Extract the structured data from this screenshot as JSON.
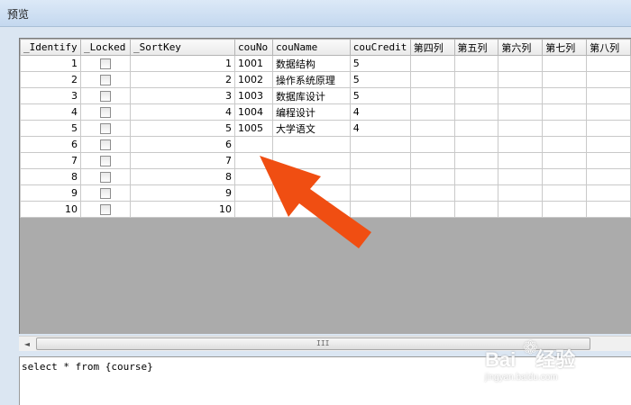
{
  "window": {
    "title": "预览"
  },
  "grid": {
    "columns": [
      "_Identify",
      "_Locked",
      "_SortKey",
      "couNo",
      "couName",
      "couCredit",
      "第四列",
      "第五列",
      "第六列",
      "第七列",
      "第八列"
    ],
    "rows": [
      {
        "identify": "1",
        "sortkey": "1",
        "couNo": "1001",
        "couName": "数据结构",
        "couCredit": "5"
      },
      {
        "identify": "2",
        "sortkey": "2",
        "couNo": "1002",
        "couName": "操作系统原理",
        "couCredit": "5"
      },
      {
        "identify": "3",
        "sortkey": "3",
        "couNo": "1003",
        "couName": "数据库设计",
        "couCredit": "5"
      },
      {
        "identify": "4",
        "sortkey": "4",
        "couNo": "1004",
        "couName": "编程设计",
        "couCredit": "4"
      },
      {
        "identify": "5",
        "sortkey": "5",
        "couNo": "1005",
        "couName": "大学语文",
        "couCredit": "4"
      },
      {
        "identify": "6",
        "sortkey": "6",
        "couNo": "",
        "couName": "",
        "couCredit": ""
      },
      {
        "identify": "7",
        "sortkey": "7",
        "couNo": "",
        "couName": "",
        "couCredit": ""
      },
      {
        "identify": "8",
        "sortkey": "8",
        "couNo": "",
        "couName": "",
        "couCredit": ""
      },
      {
        "identify": "9",
        "sortkey": "9",
        "couNo": "",
        "couName": "",
        "couCredit": ""
      },
      {
        "identify": "10",
        "sortkey": "10",
        "couNo": "",
        "couName": "",
        "couCredit": ""
      }
    ]
  },
  "scrollbar": {
    "left_arrow": "◄",
    "grip": "III"
  },
  "query": {
    "text": "select * from {course}"
  },
  "annotation": {
    "color": "#f04e12"
  },
  "watermark": {
    "logo": "Bai",
    "logo_cn": "经验",
    "sub": "jingyan.baidu.com"
  }
}
